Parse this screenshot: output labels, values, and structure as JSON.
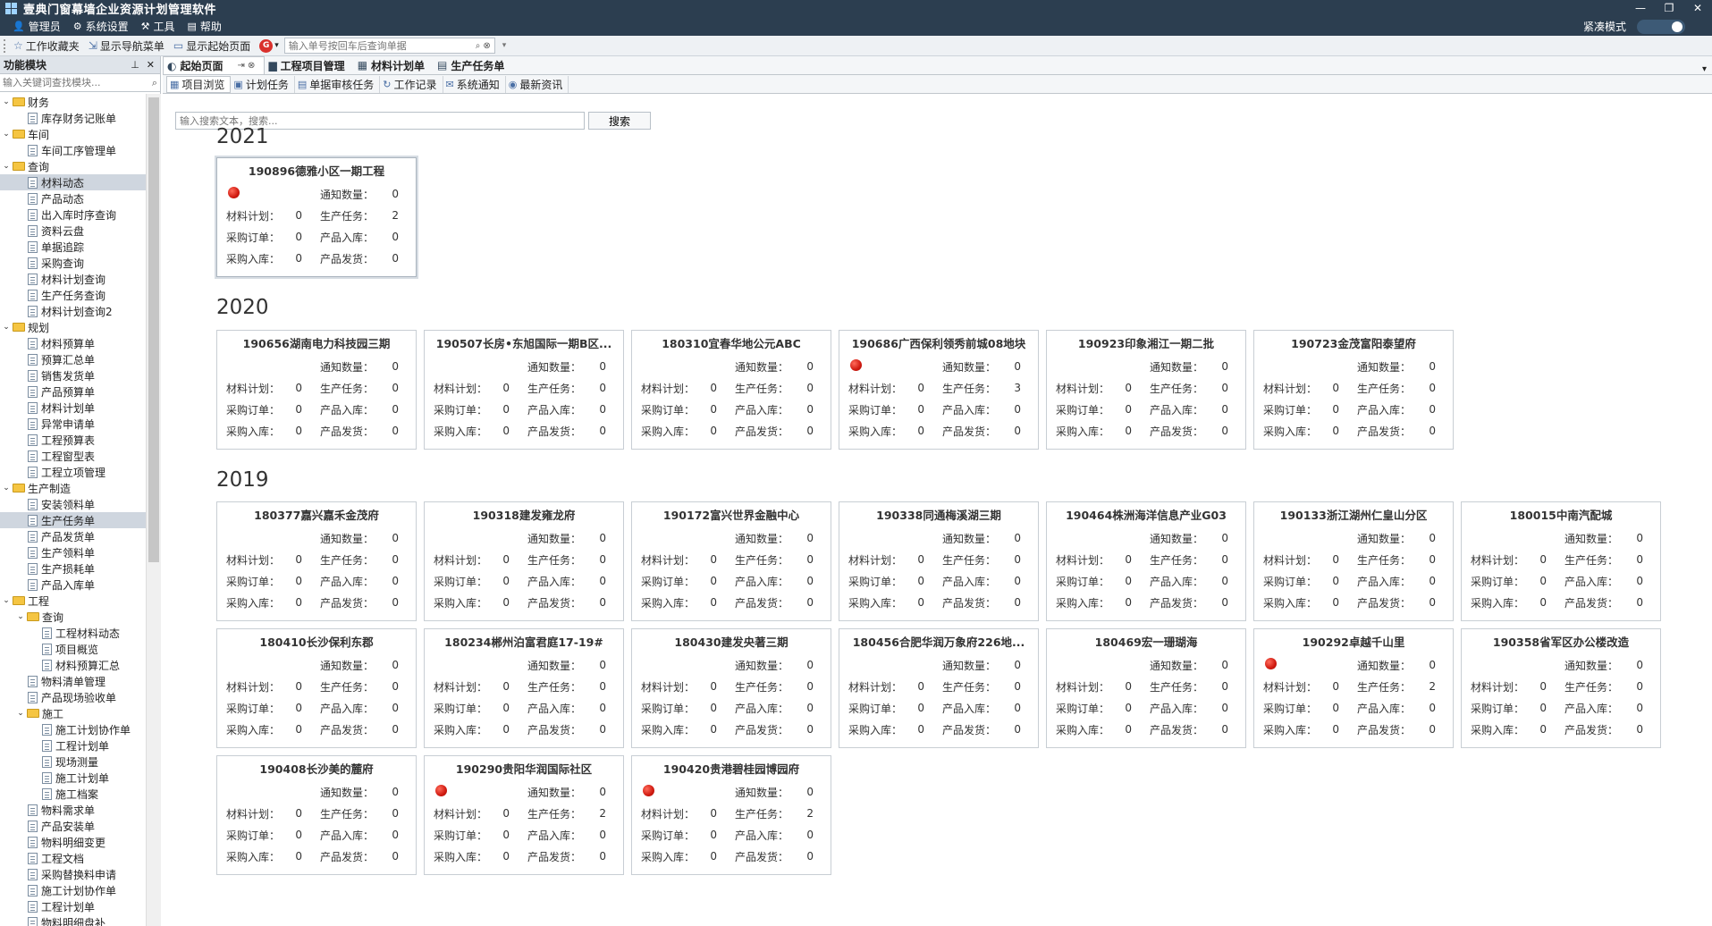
{
  "app": {
    "title": "壹典门窗幕墙企业资源计划管理软件",
    "window_controls": [
      "—",
      "❐",
      "✕"
    ]
  },
  "menu": {
    "items": [
      {
        "icon": "user-icon",
        "label": "管理员"
      },
      {
        "icon": "gear-icon",
        "label": "系统设置"
      },
      {
        "icon": "tools-icon",
        "label": "工具"
      },
      {
        "icon": "help-icon",
        "label": "帮助"
      }
    ],
    "compact_label": "紧凑模式"
  },
  "toolbar": {
    "favorites_label": "工作收藏夹",
    "show_nav_label": "显示导航菜单",
    "show_start_label": "显示起始页面",
    "search_placeholder": "输入单号按回车后查询单据"
  },
  "left_panel": {
    "title": "功能模块",
    "filter_placeholder": "输入关键词查找模块..."
  },
  "tree": [
    {
      "level": 0,
      "type": "folder",
      "label": "财务"
    },
    {
      "level": 1,
      "type": "doc",
      "label": "库存财务记账单"
    },
    {
      "level": 0,
      "type": "folder",
      "label": "车间"
    },
    {
      "level": 1,
      "type": "doc",
      "label": "车间工序管理单"
    },
    {
      "level": 0,
      "type": "folder",
      "label": "查询"
    },
    {
      "level": 1,
      "type": "doc",
      "label": "材料动态",
      "selected": true
    },
    {
      "level": 1,
      "type": "doc",
      "label": "产品动态"
    },
    {
      "level": 1,
      "type": "doc",
      "label": "出入库时序查询"
    },
    {
      "level": 1,
      "type": "doc",
      "label": "资料云盘"
    },
    {
      "level": 1,
      "type": "doc",
      "label": "单据追踪"
    },
    {
      "level": 1,
      "type": "doc",
      "label": "采购查询"
    },
    {
      "level": 1,
      "type": "doc",
      "label": "材料计划查询"
    },
    {
      "level": 1,
      "type": "doc",
      "label": "生产任务查询"
    },
    {
      "level": 1,
      "type": "doc",
      "label": "材料计划查询2"
    },
    {
      "level": 0,
      "type": "folder",
      "label": "规划"
    },
    {
      "level": 1,
      "type": "doc",
      "label": "材料预算单"
    },
    {
      "level": 1,
      "type": "doc",
      "label": "预算汇总单"
    },
    {
      "level": 1,
      "type": "doc",
      "label": "销售发货单"
    },
    {
      "level": 1,
      "type": "doc",
      "label": "产品预算单"
    },
    {
      "level": 1,
      "type": "doc",
      "label": "材料计划单"
    },
    {
      "level": 1,
      "type": "doc",
      "label": "异常申请单"
    },
    {
      "level": 1,
      "type": "doc",
      "label": "工程预算表"
    },
    {
      "level": 1,
      "type": "doc",
      "label": "工程窗型表"
    },
    {
      "level": 1,
      "type": "doc",
      "label": "工程立项管理"
    },
    {
      "level": 0,
      "type": "folder",
      "label": "生产制造"
    },
    {
      "level": 1,
      "type": "doc",
      "label": "安装领料单"
    },
    {
      "level": 1,
      "type": "doc",
      "label": "生产任务单",
      "selected": true
    },
    {
      "level": 1,
      "type": "doc",
      "label": "产品发货单"
    },
    {
      "level": 1,
      "type": "doc",
      "label": "生产领料单"
    },
    {
      "level": 1,
      "type": "doc",
      "label": "生产损耗单"
    },
    {
      "level": 1,
      "type": "doc",
      "label": "产品入库单"
    },
    {
      "level": 0,
      "type": "folder",
      "label": "工程"
    },
    {
      "level": 1,
      "type": "folder",
      "label": "查询"
    },
    {
      "level": 2,
      "type": "doc",
      "label": "工程材料动态"
    },
    {
      "level": 2,
      "type": "doc",
      "label": "项目概览"
    },
    {
      "level": 2,
      "type": "doc",
      "label": "材料预算汇总"
    },
    {
      "level": 1,
      "type": "doc",
      "label": "物料清单管理"
    },
    {
      "level": 1,
      "type": "doc",
      "label": "产品现场验收单"
    },
    {
      "level": 1,
      "type": "folder",
      "label": "施工"
    },
    {
      "level": 2,
      "type": "doc",
      "label": "施工计划协作单"
    },
    {
      "level": 2,
      "type": "doc",
      "label": "工程计划单"
    },
    {
      "level": 2,
      "type": "doc",
      "label": "现场测量"
    },
    {
      "level": 2,
      "type": "doc",
      "label": "施工计划单"
    },
    {
      "level": 2,
      "type": "doc",
      "label": "施工档案"
    },
    {
      "level": 1,
      "type": "doc",
      "label": "物料需求单"
    },
    {
      "level": 1,
      "type": "doc",
      "label": "产品安装单"
    },
    {
      "level": 1,
      "type": "doc",
      "label": "物料明细变更"
    },
    {
      "level": 1,
      "type": "doc",
      "label": "工程文档"
    },
    {
      "level": 1,
      "type": "doc",
      "label": "采购替换料申请"
    },
    {
      "level": 1,
      "type": "doc",
      "label": "施工计划协作单"
    },
    {
      "level": 1,
      "type": "doc",
      "label": "工程计划单"
    },
    {
      "level": 1,
      "type": "doc",
      "label": "物料明细盘补"
    }
  ],
  "doc_tabs": [
    {
      "label": "起始页面",
      "active": true,
      "controls": "⇥  ⊗"
    },
    {
      "label": "工程项目管理"
    },
    {
      "label": "材料计划单"
    },
    {
      "label": "生产任务单"
    }
  ],
  "sub_tabs": [
    {
      "label": "项目浏览",
      "active": true
    },
    {
      "label": "计划任务"
    },
    {
      "label": "单据审核任务"
    },
    {
      "label": "工作记录"
    },
    {
      "label": "系统通知"
    },
    {
      "label": "最新资讯"
    }
  ],
  "search": {
    "placeholder": "输入搜索文本，搜索...",
    "button_label": "搜索"
  },
  "field_labels": {
    "notice": "通知数量：",
    "mat_plan": "材料计划：",
    "prod_task": "生产任务：",
    "purchase_order": "采购订单：",
    "prod_in": "产品入库：",
    "purchase_in": "采购入库：",
    "prod_ship": "产品发货："
  },
  "years": [
    {
      "year": "2021",
      "cards": [
        {
          "title": "190896德雅小区一期工程",
          "alert": true,
          "notice": 0,
          "mat_plan": 0,
          "prod_task": 2,
          "purchase_order": 0,
          "prod_in": 0,
          "purchase_in": 0,
          "prod_ship": 0,
          "selected": true
        }
      ]
    },
    {
      "year": "2020",
      "cards": [
        {
          "title": "190656湖南电力科技园三期",
          "alert": false,
          "notice": 0,
          "mat_plan": 0,
          "prod_task": 0,
          "purchase_order": 0,
          "prod_in": 0,
          "purchase_in": 0,
          "prod_ship": 0
        },
        {
          "title": "190507长房•东旭国际一期B区...",
          "alert": false,
          "notice": 0,
          "mat_plan": 0,
          "prod_task": 0,
          "purchase_order": 0,
          "prod_in": 0,
          "purchase_in": 0,
          "prod_ship": 0
        },
        {
          "title": "180310宜春华地公元ABC",
          "alert": false,
          "notice": 0,
          "mat_plan": 0,
          "prod_task": 0,
          "purchase_order": 0,
          "prod_in": 0,
          "purchase_in": 0,
          "prod_ship": 0
        },
        {
          "title": "190686广西保利领秀前城08地块",
          "alert": true,
          "notice": 0,
          "mat_plan": 0,
          "prod_task": 3,
          "purchase_order": 0,
          "prod_in": 0,
          "purchase_in": 0,
          "prod_ship": 0
        },
        {
          "title": "190923印象湘江一期二批",
          "alert": false,
          "notice": 0,
          "mat_plan": 0,
          "prod_task": 0,
          "purchase_order": 0,
          "prod_in": 0,
          "purchase_in": 0,
          "prod_ship": 0
        },
        {
          "title": "190723金茂富阳泰望府",
          "alert": false,
          "notice": 0,
          "mat_plan": 0,
          "prod_task": 0,
          "purchase_order": 0,
          "prod_in": 0,
          "purchase_in": 0,
          "prod_ship": 0
        }
      ]
    },
    {
      "year": "2019",
      "cards": [
        {
          "title": "180377嘉兴嘉禾金茂府",
          "alert": false,
          "notice": 0,
          "mat_plan": 0,
          "prod_task": 0,
          "purchase_order": 0,
          "prod_in": 0,
          "purchase_in": 0,
          "prod_ship": 0
        },
        {
          "title": "190318建发雍龙府",
          "alert": false,
          "notice": 0,
          "mat_plan": 0,
          "prod_task": 0,
          "purchase_order": 0,
          "prod_in": 0,
          "purchase_in": 0,
          "prod_ship": 0
        },
        {
          "title": "190172富兴世界金融中心",
          "alert": false,
          "notice": 0,
          "mat_plan": 0,
          "prod_task": 0,
          "purchase_order": 0,
          "prod_in": 0,
          "purchase_in": 0,
          "prod_ship": 0
        },
        {
          "title": "190338同通梅溪湖三期",
          "alert": false,
          "notice": 0,
          "mat_plan": 0,
          "prod_task": 0,
          "purchase_order": 0,
          "prod_in": 0,
          "purchase_in": 0,
          "prod_ship": 0
        },
        {
          "title": "190464株洲海洋信息产业G03",
          "alert": false,
          "notice": 0,
          "mat_plan": 0,
          "prod_task": 0,
          "purchase_order": 0,
          "prod_in": 0,
          "purchase_in": 0,
          "prod_ship": 0
        },
        {
          "title": "190133浙江湖州仁皇山分区",
          "alert": false,
          "notice": 0,
          "mat_plan": 0,
          "prod_task": 0,
          "purchase_order": 0,
          "prod_in": 0,
          "purchase_in": 0,
          "prod_ship": 0
        },
        {
          "title": "180015中南汽配城",
          "alert": false,
          "notice": 0,
          "mat_plan": 0,
          "prod_task": 0,
          "purchase_order": 0,
          "prod_in": 0,
          "purchase_in": 0,
          "prod_ship": 0
        },
        {
          "title": "180410长沙保利东郡",
          "alert": false,
          "notice": 0,
          "mat_plan": 0,
          "prod_task": 0,
          "purchase_order": 0,
          "prod_in": 0,
          "purchase_in": 0,
          "prod_ship": 0
        },
        {
          "title": "180234郴州泊富君庭17-19#",
          "alert": false,
          "notice": 0,
          "mat_plan": 0,
          "prod_task": 0,
          "purchase_order": 0,
          "prod_in": 0,
          "purchase_in": 0,
          "prod_ship": 0
        },
        {
          "title": "180430建发央著三期",
          "alert": false,
          "notice": 0,
          "mat_plan": 0,
          "prod_task": 0,
          "purchase_order": 0,
          "prod_in": 0,
          "purchase_in": 0,
          "prod_ship": 0
        },
        {
          "title": "180456合肥华润万象府226地...",
          "alert": false,
          "notice": 0,
          "mat_plan": 0,
          "prod_task": 0,
          "purchase_order": 0,
          "prod_in": 0,
          "purchase_in": 0,
          "prod_ship": 0
        },
        {
          "title": "180469宏一珊瑚海",
          "alert": false,
          "notice": 0,
          "mat_plan": 0,
          "prod_task": 0,
          "purchase_order": 0,
          "prod_in": 0,
          "purchase_in": 0,
          "prod_ship": 0
        },
        {
          "title": "190292卓越千山里",
          "alert": true,
          "notice": 0,
          "mat_plan": 0,
          "prod_task": 2,
          "purchase_order": 0,
          "prod_in": 0,
          "purchase_in": 0,
          "prod_ship": 0
        },
        {
          "title": "190358省军区办公楼改造",
          "alert": false,
          "notice": 0,
          "mat_plan": 0,
          "prod_task": 0,
          "purchase_order": 0,
          "prod_in": 0,
          "purchase_in": 0,
          "prod_ship": 0
        },
        {
          "title": "190408长沙美的麓府",
          "alert": false,
          "notice": 0,
          "mat_plan": 0,
          "prod_task": 0,
          "purchase_order": 0,
          "prod_in": 0,
          "purchase_in": 0,
          "prod_ship": 0
        },
        {
          "title": "190290贵阳华润国际社区",
          "alert": true,
          "notice": 0,
          "mat_plan": 0,
          "prod_task": 2,
          "purchase_order": 0,
          "prod_in": 0,
          "purchase_in": 0,
          "prod_ship": 0
        },
        {
          "title": "190420贵港碧桂园博园府",
          "alert": true,
          "notice": 0,
          "mat_plan": 0,
          "prod_task": 2,
          "purchase_order": 0,
          "prod_in": 0,
          "purchase_in": 0,
          "prod_ship": 0
        }
      ]
    }
  ]
}
